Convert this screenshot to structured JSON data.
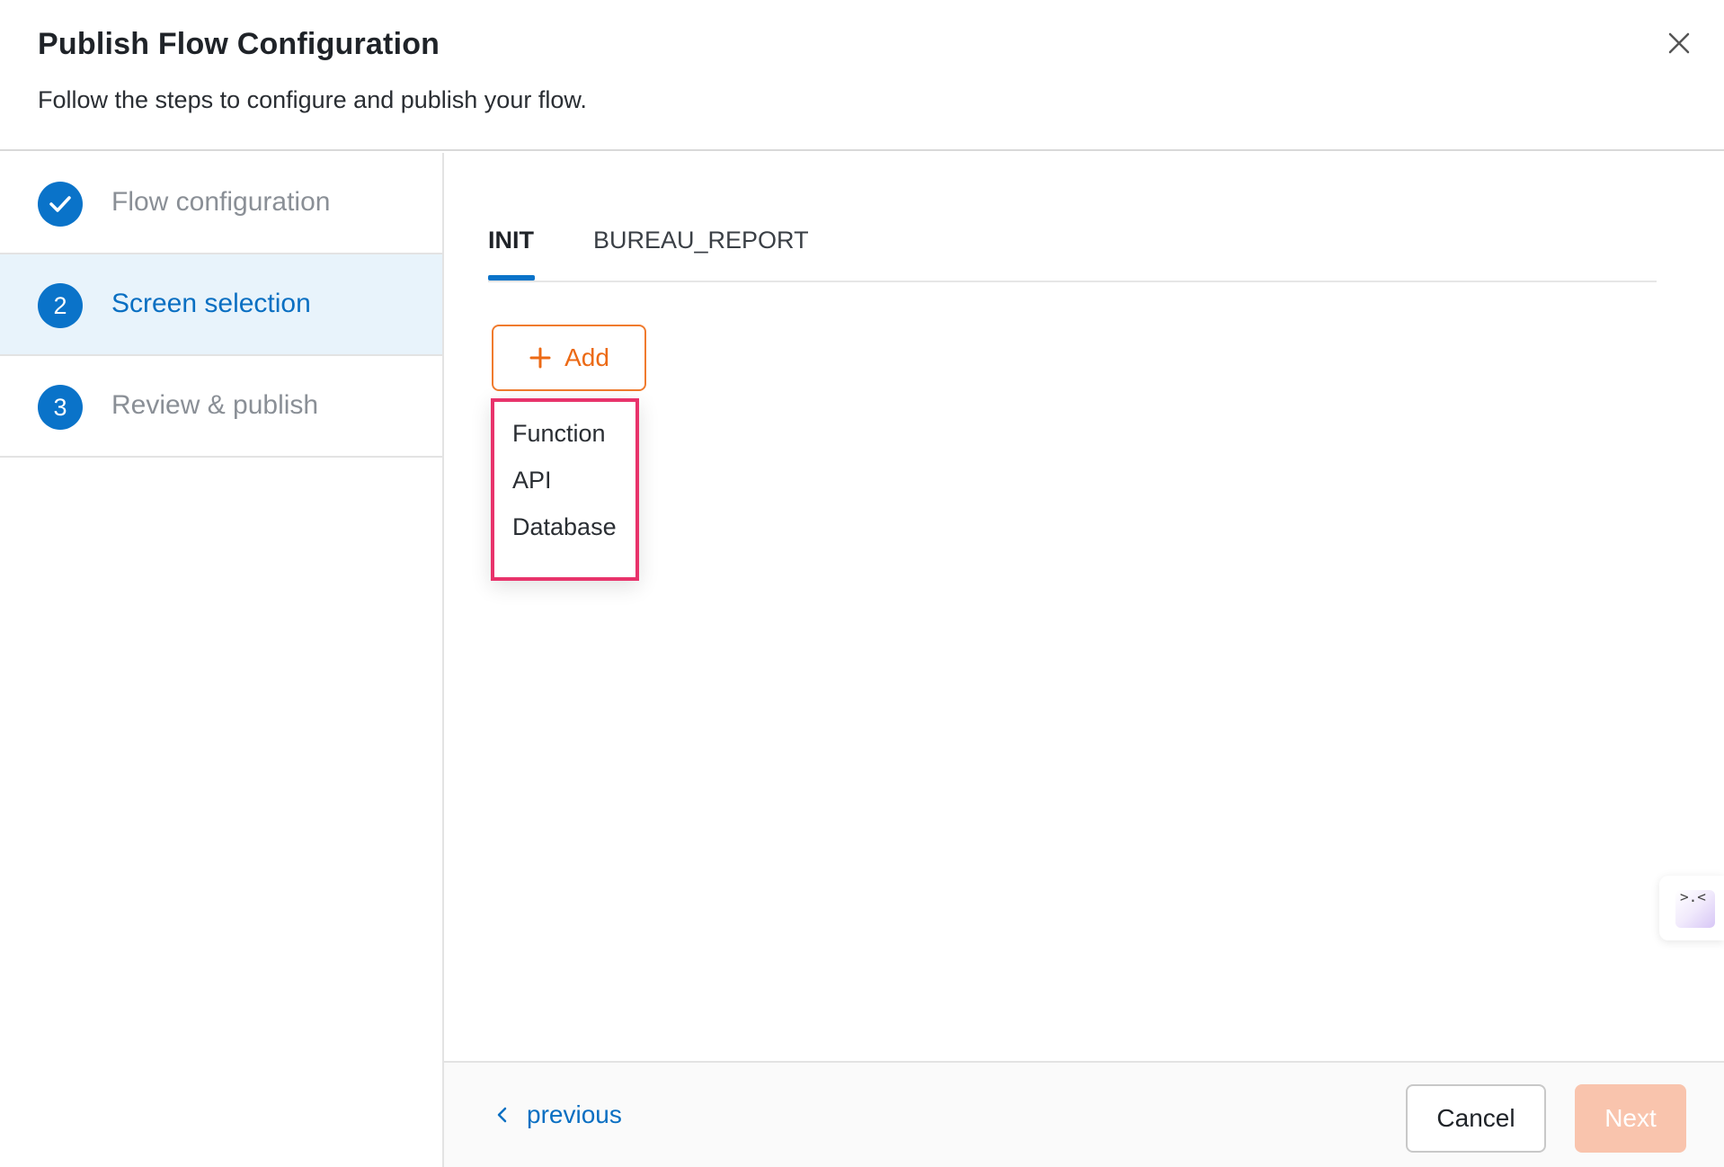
{
  "dialog": {
    "title": "Publish Flow Configuration",
    "subtitle": "Follow the steps to configure and publish your flow."
  },
  "stepper": {
    "steps": [
      {
        "number": "",
        "label": "Flow configuration",
        "state": "completed"
      },
      {
        "number": "2",
        "label": "Screen selection",
        "state": "active"
      },
      {
        "number": "3",
        "label": "Review & publish",
        "state": "pending"
      }
    ]
  },
  "tabs": [
    {
      "label": "INIT",
      "active": true
    },
    {
      "label": "BUREAU_REPORT",
      "active": false
    }
  ],
  "add_button": {
    "label": "Add"
  },
  "add_menu": {
    "items": [
      {
        "label": "Function"
      },
      {
        "label": "API"
      },
      {
        "label": "Database"
      }
    ]
  },
  "footer": {
    "previous_label": "previous",
    "cancel_label": "Cancel",
    "next_label": "Next"
  },
  "widget": {
    "glyph": ">.<"
  },
  "colors": {
    "primary": "#0a73c9",
    "accent": "#ec6a15",
    "highlight_border": "#e8336b",
    "next_disabled": "#f9c4ad"
  }
}
